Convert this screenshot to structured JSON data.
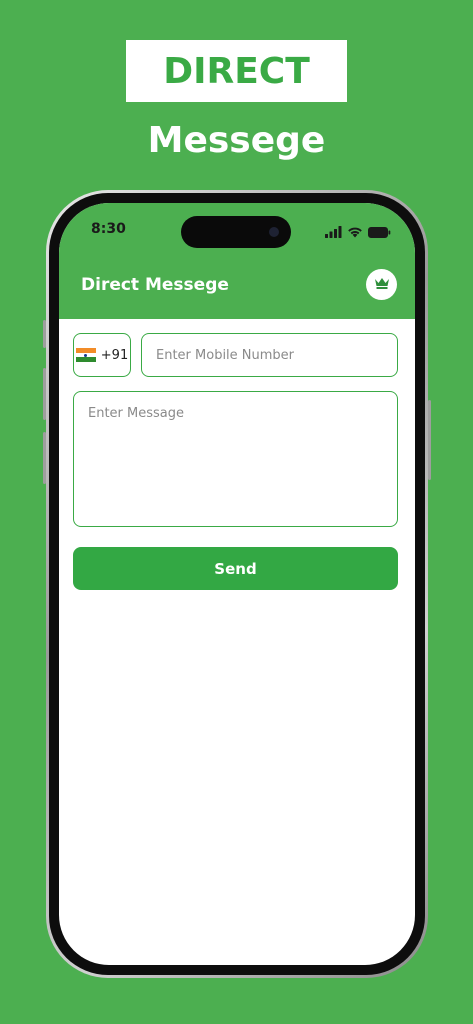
{
  "banner": {
    "title": "DIRECT",
    "subtitle": "Messege"
  },
  "status_bar": {
    "time": "8:30"
  },
  "header": {
    "title": "Direct Messege",
    "premium_icon": "crown-icon"
  },
  "country": {
    "code": "+91",
    "flag": "india-flag"
  },
  "mobile_field": {
    "placeholder": "Enter Mobile Number",
    "value": ""
  },
  "message_field": {
    "placeholder": "Enter Message",
    "value": ""
  },
  "send_button": {
    "label": "Send"
  },
  "colors": {
    "background": "#4caf50",
    "accent": "#33a844",
    "border": "#3aaa45",
    "screen": "#ffffff"
  }
}
